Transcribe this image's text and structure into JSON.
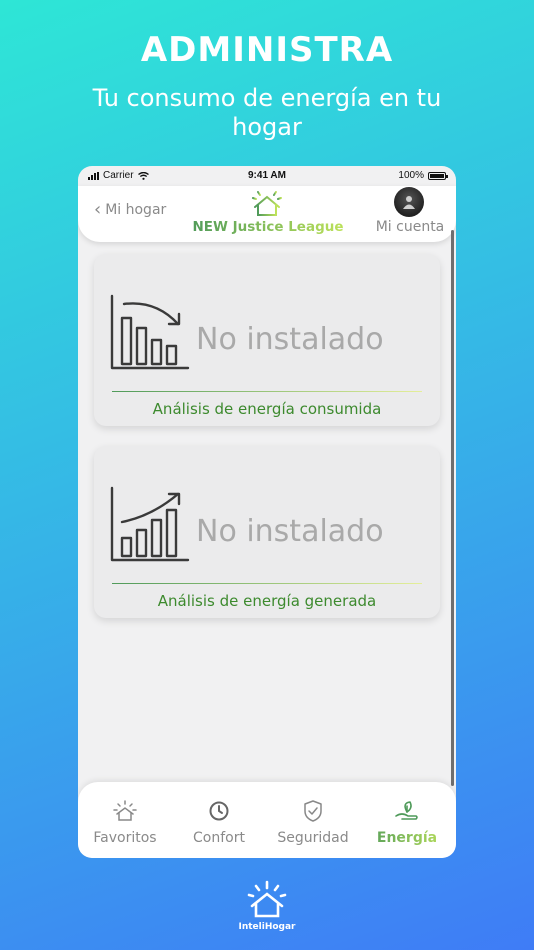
{
  "promo": {
    "headline": "ADMINISTRA",
    "subline": "Tu consumo de energía en tu hogar"
  },
  "status_bar": {
    "carrier": "Carrier",
    "time": "9:41 AM",
    "battery": "100%"
  },
  "header": {
    "back_label": "Mi hogar",
    "home_name": "NEW Justice League",
    "account_label": "Mi cuenta"
  },
  "cards": [
    {
      "status": "No instalado",
      "caption": "Análisis de energía consumida",
      "icon": "chart-down-icon"
    },
    {
      "status": "No instalado",
      "caption": "Análisis de energía generada",
      "icon": "chart-up-icon"
    }
  ],
  "tabs": [
    {
      "label": "Favoritos",
      "icon": "sun-house-icon"
    },
    {
      "label": "Confort",
      "icon": "clock-icon"
    },
    {
      "label": "Seguridad",
      "icon": "shield-icon"
    },
    {
      "label": "Energía",
      "icon": "leaf-hand-icon",
      "active": true
    }
  ],
  "brand": {
    "name": "InteliHogar"
  },
  "colors": {
    "accent_green": "#3d8a2e",
    "accent_gradient_start": "#4f9a5a",
    "accent_gradient_end": "#bfe35a",
    "background_top": "#2ee6d6",
    "background_bottom": "#3f7cf6"
  }
}
